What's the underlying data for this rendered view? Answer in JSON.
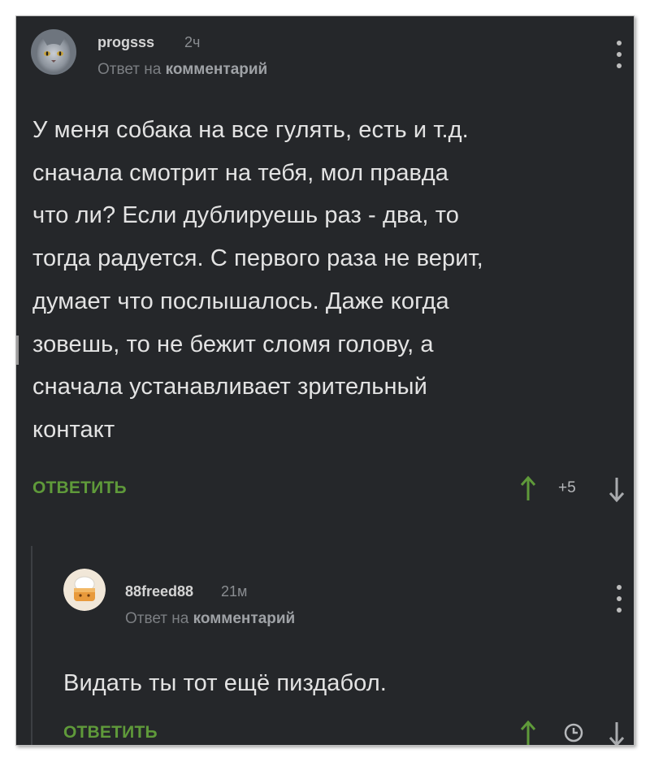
{
  "comments": [
    {
      "username": "progsss",
      "time": "2ч",
      "reply_prefix": "Ответ на",
      "reply_target": "комментарий",
      "text_lines": [
        "У меня собака на все гулять, есть и т.д.",
        "сначала смотрит на тебя, мол правда",
        "что ли? Если дублируешь раз - два, то",
        "тогда радуется. С первого раза не верит,",
        "думает что послышалось. Даже когда",
        "зовешь, то не бежит сломя голову, а",
        "сначала устанавливает зрительный",
        "контакт"
      ],
      "reply_button": "ОТВЕТИТЬ",
      "score": "+5",
      "avatar_icon": "cat-avatar-icon"
    },
    {
      "username": "88freed88",
      "time": "21м",
      "reply_prefix": "Ответ на",
      "reply_target": "комментарий",
      "text": "Видать ты тот ещё пиздабол.",
      "reply_button": "ОТВЕТИТЬ",
      "avatar_icon": "bun-avatar-icon",
      "score_icon": "clock-icon"
    }
  ],
  "colors": {
    "background": "#25272a",
    "accent_green": "#5f9a3a",
    "text": "#e3e3e3",
    "muted": "#8a8d91"
  }
}
